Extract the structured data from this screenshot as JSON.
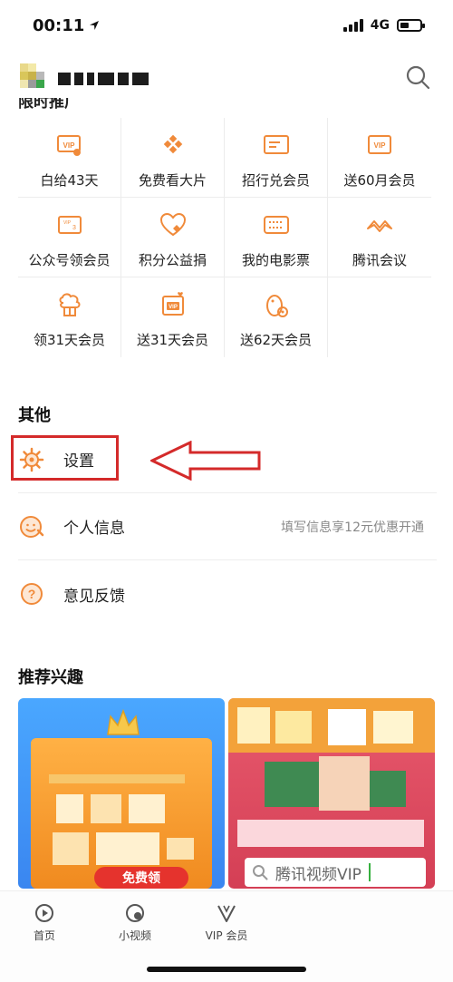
{
  "status_bar": {
    "time": "00:11",
    "network": "4G"
  },
  "header": {
    "search_icon": "search-icon"
  },
  "section_partial_title": "限时推广",
  "grid": [
    [
      {
        "label": "白给43天",
        "icon": "vip-card-icon"
      },
      {
        "label": "免费看大片",
        "icon": "diamond-grid-icon"
      },
      {
        "label": "招行兑会员",
        "icon": "bank-card-icon"
      },
      {
        "label": "送60月会员",
        "icon": "vip-ticket-icon"
      }
    ],
    [
      {
        "label": "公众号领会员",
        "icon": "vip-coupon-icon"
      },
      {
        "label": "积分公益捐",
        "icon": "heart-icon"
      },
      {
        "label": "我的电影票",
        "icon": "movie-ticket-icon"
      },
      {
        "label": "腾讯会议",
        "icon": "meeting-icon"
      }
    ],
    [
      {
        "label": "领31天会员",
        "icon": "gift-cloud-icon"
      },
      {
        "label": "送31天会员",
        "icon": "vip-heart-card-icon"
      },
      {
        "label": "送62天会员",
        "icon": "penguin-icon"
      }
    ]
  ],
  "other": {
    "title": "其他",
    "items": [
      {
        "label": "设置",
        "icon": "gear-icon",
        "right": ""
      },
      {
        "label": "个人信息",
        "icon": "smile-edit-icon",
        "right": "填写信息享12元优惠开通"
      },
      {
        "label": "意见反馈",
        "icon": "question-icon",
        "right": ""
      }
    ]
  },
  "recommend": {
    "title": "推荐兴趣",
    "left_card": {
      "button": "免费领"
    },
    "right_card": {
      "search_text": "腾讯视频VIP"
    }
  },
  "tab_bar": [
    {
      "label": "首页",
      "icon": "home-play-icon"
    },
    {
      "label": "小视频",
      "icon": "short-video-icon"
    },
    {
      "label": "VIP 会员",
      "icon": "vip-crown-icon"
    }
  ],
  "colors": {
    "accent": "#f0883a",
    "annotation": "#d42a2a"
  }
}
